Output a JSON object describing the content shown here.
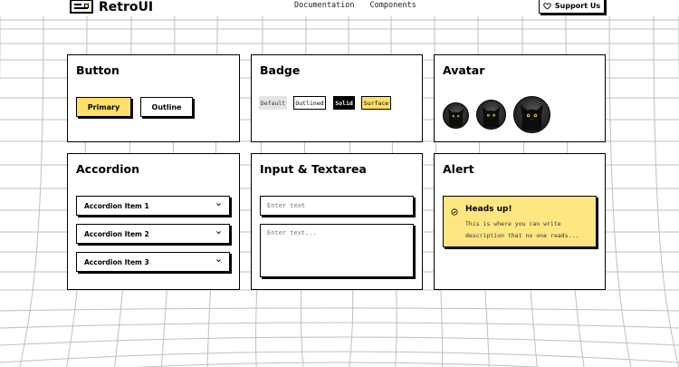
{
  "header": {
    "app_name": "RetroUI",
    "nav": [
      "Documentation",
      "Components"
    ],
    "support_label": "Support Us"
  },
  "cards": {
    "button": {
      "title": "Button",
      "primary_label": "Primary",
      "outline_label": "Outline"
    },
    "badge": {
      "title": "Badge",
      "labels": [
        "Default",
        "Outlined",
        "Solid",
        "Surface"
      ]
    },
    "avatar": {
      "title": "Avatar",
      "sizes": [
        "sm",
        "md",
        "lg"
      ]
    },
    "accordion": {
      "title": "Accordion",
      "items": [
        "Accordion Item 1",
        "Accordion Item 2",
        "Accordion Item 3"
      ]
    },
    "input": {
      "title": "Input & Textarea",
      "input_placeholder": "Enter text",
      "textarea_placeholder": "Enter text..."
    },
    "alert": {
      "title": "Alert",
      "heading": "Heads up!",
      "description": "This is where you can write description that no one reads..."
    }
  },
  "colors": {
    "accent": "#ffe066",
    "alert_bg": "#ffe680",
    "border": "#000000",
    "grid_line": "#bfbfbf"
  },
  "icons": {
    "logo": "window-icon",
    "support": "heart-icon",
    "accordion": "chevron-down-icon",
    "alert": "circle-check-icon"
  }
}
